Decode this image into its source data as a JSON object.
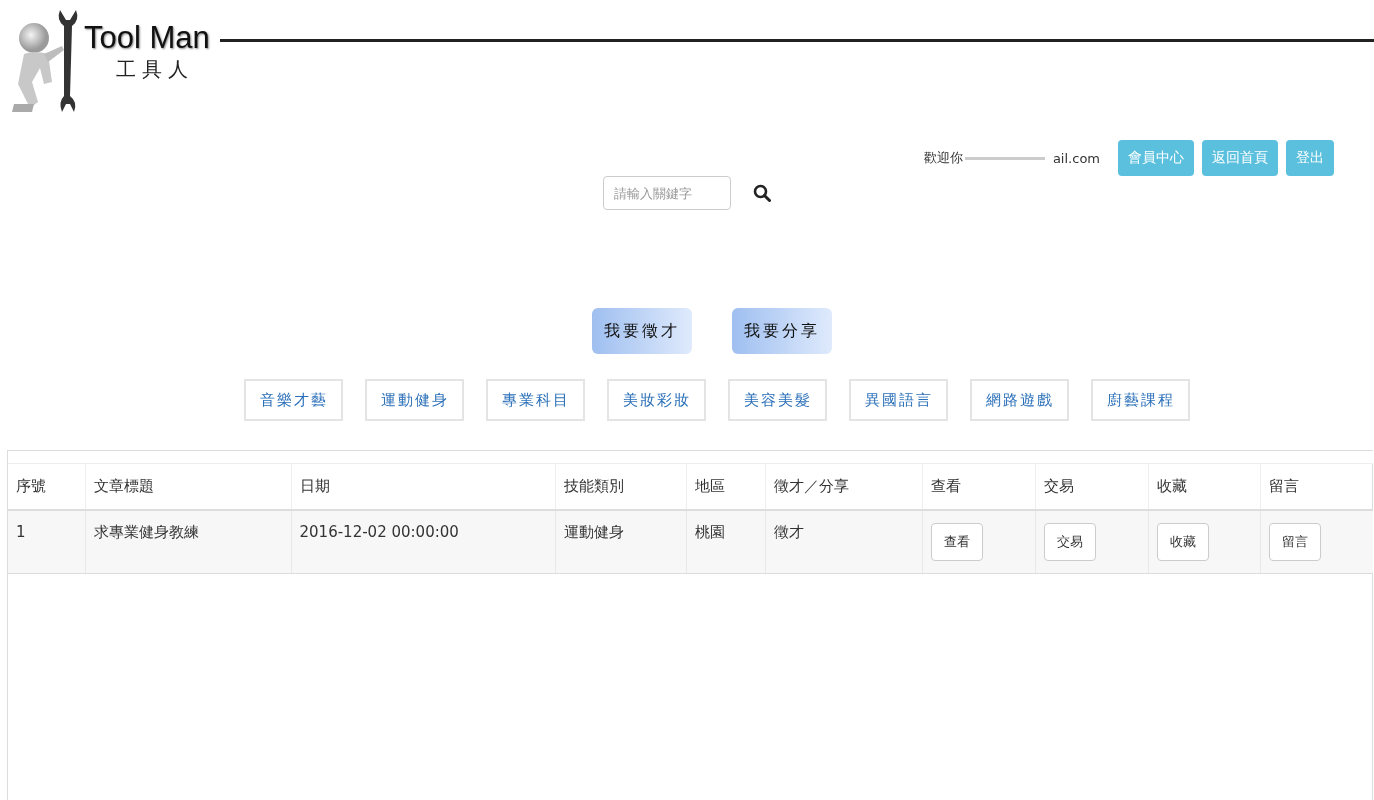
{
  "logo": {
    "title": "Tool Man",
    "subtitle": "工具人"
  },
  "user_bar": {
    "welcome": "歡迎你",
    "email_visible": "ail.com",
    "buttons": [
      "會員中心",
      "返回首頁",
      "登出"
    ]
  },
  "search": {
    "placeholder": "請輸入關鍵字"
  },
  "post_buttons": [
    "我要徵才",
    "我要分享"
  ],
  "categories": [
    "音樂才藝",
    "運動健身",
    "專業科目",
    "美妝彩妝",
    "美容美髮",
    "異國語言",
    "網路遊戲",
    "廚藝課程"
  ],
  "table": {
    "columns": [
      "序號",
      "文章標題",
      "日期",
      "技能類別",
      "地區",
      "徵才／分享",
      "查看",
      "交易",
      "收藏",
      "留言"
    ],
    "rows": [
      {
        "cells": [
          {
            "kind": "text",
            "text": "1"
          },
          {
            "kind": "text",
            "text": "求專業健身教練"
          },
          {
            "kind": "text",
            "text": "2016-12-02 00:00:00"
          },
          {
            "kind": "text",
            "text": "運動健身"
          },
          {
            "kind": "text",
            "text": "桃園"
          },
          {
            "kind": "text",
            "text": "徵才"
          },
          {
            "kind": "button",
            "text": "查看"
          },
          {
            "kind": "button",
            "text": "交易"
          },
          {
            "kind": "button",
            "text": "收藏"
          },
          {
            "kind": "button",
            "text": "留言"
          }
        ]
      }
    ]
  }
}
